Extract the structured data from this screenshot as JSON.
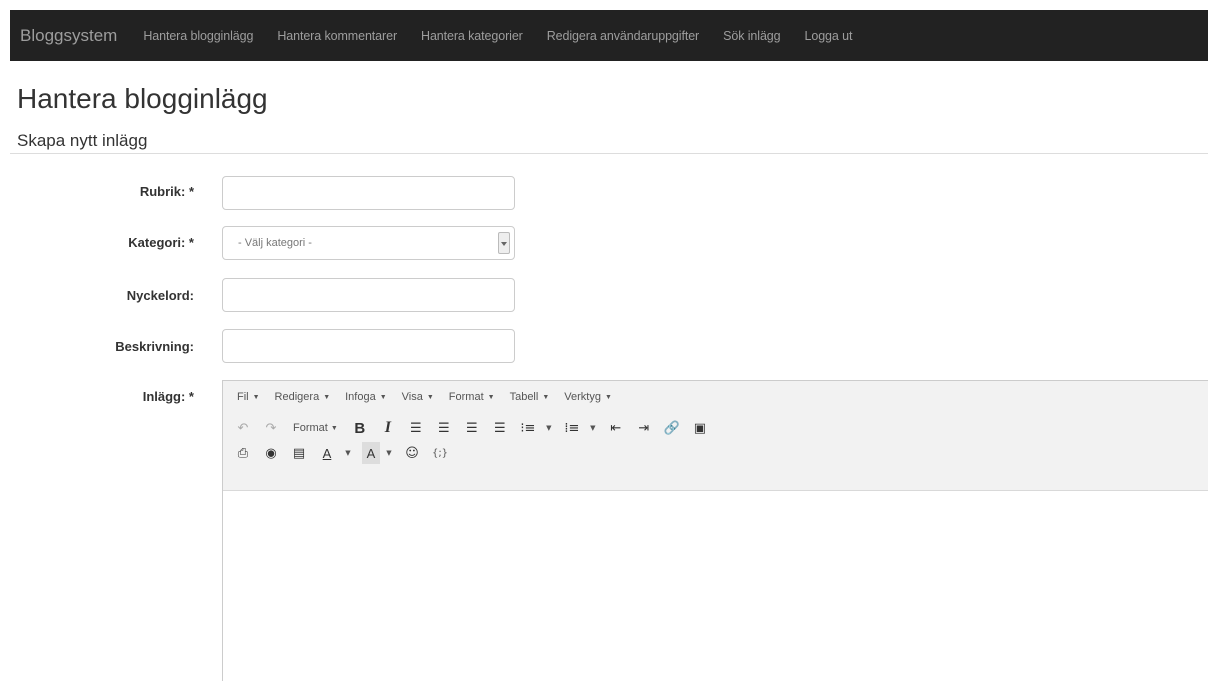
{
  "navbar": {
    "brand": "Bloggsystem",
    "items": [
      "Hantera blogginlägg",
      "Hantera kommentarer",
      "Hantera kategorier",
      "Redigera användaruppgifter",
      "Sök inlägg",
      "Logga ut"
    ]
  },
  "page": {
    "title": "Hantera blogginlägg",
    "section": "Skapa nytt inlägg"
  },
  "form": {
    "rubrik_label": "Rubrik: *",
    "rubrik_value": "",
    "kategori_label": "Kategori: *",
    "kategori_selected": "- Välj kategori -",
    "nyckelord_label": "Nyckelord:",
    "nyckelord_value": "",
    "beskrivning_label": "Beskrivning:",
    "beskrivning_value": "",
    "inlagg_label": "Inlägg: *"
  },
  "editor": {
    "menu": [
      "Fil",
      "Redigera",
      "Infoga",
      "Visa",
      "Format",
      "Tabell",
      "Verktyg"
    ],
    "format_label": "Format",
    "bold": "B",
    "italic": "I",
    "code": "{;}",
    "icons": [
      "undo-icon",
      "redo-icon",
      "bold-icon",
      "italic-icon",
      "align-left-icon",
      "align-center-icon",
      "align-right-icon",
      "align-justify-icon",
      "bullet-list-icon",
      "numbered-list-icon",
      "outdent-icon",
      "indent-icon",
      "link-icon",
      "image-icon",
      "print-icon",
      "preview-icon",
      "media-icon",
      "text-color-icon",
      "background-color-icon",
      "emoticon-icon",
      "code-icon"
    ]
  }
}
